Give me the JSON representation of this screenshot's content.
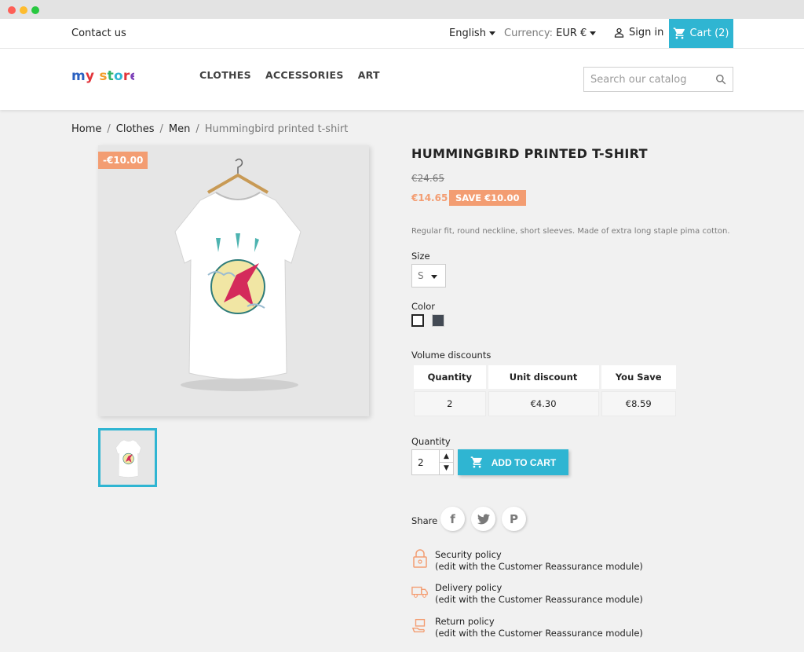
{
  "topbar": {
    "contact": "Contact us",
    "language": "English",
    "currency_label": "Currency:",
    "currency_value": "EUR €",
    "sign_in": "Sign in",
    "cart": "Cart (2)"
  },
  "header": {
    "logo": "my store",
    "nav": [
      "CLOTHES",
      "ACCESSORIES",
      "ART"
    ],
    "search_placeholder": "Search our catalog"
  },
  "breadcrumb": [
    "Home",
    "Clothes",
    "Men",
    "Hummingbird printed t-shirt"
  ],
  "product": {
    "discount_flag": "-€10.00",
    "title": "HUMMINGBIRD PRINTED T-SHIRT",
    "regular_price": "€24.65",
    "price": "€14.65",
    "save_badge": "SAVE €10.00",
    "description": "Regular fit, round neckline, short sleeves. Made of extra long staple pima cotton.",
    "size_label": "Size",
    "size_value": "S",
    "color_label": "Color",
    "colors": [
      "#ffffff",
      "#434a54"
    ]
  },
  "volume": {
    "title": "Volume discounts",
    "headers": [
      "Quantity",
      "Unit discount",
      "You Save"
    ],
    "rows": [
      [
        "2",
        "€4.30",
        "€8.59"
      ]
    ]
  },
  "purchase": {
    "quantity_label": "Quantity",
    "quantity_value": "2",
    "add_to_cart": "ADD TO CART"
  },
  "share": {
    "label": "Share"
  },
  "policies": [
    {
      "title": "Security policy",
      "sub": "(edit with the Customer Reassurance module)"
    },
    {
      "title": "Delivery policy",
      "sub": "(edit with the Customer Reassurance module)"
    },
    {
      "title": "Return policy",
      "sub": "(edit with the Customer Reassurance module)"
    }
  ],
  "colors": {
    "accent": "#2fb5d2",
    "discount": "#f39d72"
  }
}
